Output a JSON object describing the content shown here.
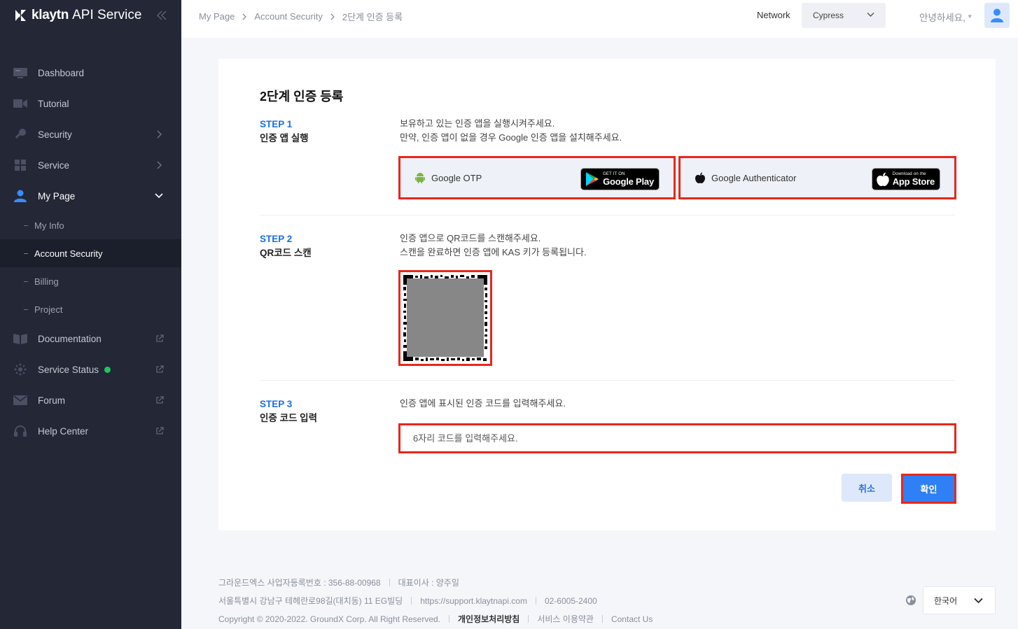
{
  "sidebar": {
    "brand": "klaytn",
    "service_name": "API Service",
    "items": [
      {
        "label": "Dashboard"
      },
      {
        "label": "Tutorial"
      },
      {
        "label": "Security"
      },
      {
        "label": "Service"
      },
      {
        "label": "My Page"
      }
    ],
    "subitems": [
      {
        "label": "My Info"
      },
      {
        "label": "Account Security"
      },
      {
        "label": "Billing"
      },
      {
        "label": "Project"
      }
    ],
    "links": [
      {
        "label": "Documentation"
      },
      {
        "label": "Service Status"
      },
      {
        "label": "Forum"
      },
      {
        "label": "Help Center"
      }
    ]
  },
  "header": {
    "breadcrumb": [
      "My Page",
      "Account Security",
      "2단계 인증 등록"
    ],
    "network_label": "Network",
    "network_value": "Cypress",
    "greeting": "안녕하세요, *"
  },
  "main": {
    "title": "2단계 인증 등록",
    "step1": {
      "num": "STEP 1",
      "name": "인증 앱 실행",
      "desc_line1": "보유하고 있는 인증 앱을 실행시켜주세요.",
      "desc_line2": "만약, 인증 앱이 없을 경우 Google 인증 앱을 설치해주세요.",
      "apps": [
        {
          "name": "Google OTP",
          "badge_small": "GET IT ON",
          "badge_big": "Google Play"
        },
        {
          "name": "Google Authenticator",
          "badge_small": "Download on the",
          "badge_big": "App Store"
        }
      ]
    },
    "step2": {
      "num": "STEP 2",
      "name": "QR코드 스캔",
      "desc_line1": "인증 앱으로 QR코드를 스캔해주세요.",
      "desc_line2": "스캔을 완료하면 인증 앱에 KAS 키가 등록됩니다."
    },
    "step3": {
      "num": "STEP 3",
      "name": "인증 코드 입력",
      "desc_line1": "인증 앱에 표시된 인증 코드를 입력해주세요.",
      "placeholder": "6자리 코드를 입력해주세요."
    },
    "cancel_label": "취소",
    "confirm_label": "확인"
  },
  "footer": {
    "company": "그라운드엑스 사업자등록번호 : 356-88-00968",
    "ceo": "대표이사 : 양주일",
    "address": "서울특별시 강남구 테헤란로98길(대치동) 11 EG빌딩",
    "support_url": "https://support.klaytnapi.com",
    "phone": "02-6005-2400",
    "copyright": "Copyright © 2020-2022. GroundX Corp. All Right Reserved.",
    "privacy": "개인정보처리방침",
    "terms": "서비스 이용약관",
    "contact": "Contact Us",
    "language": "한국어"
  },
  "colors": {
    "sidebar_bg": "#232736",
    "accent": "#2f7ff5",
    "highlight": "#e8271b",
    "status_ok": "#21c45d"
  }
}
